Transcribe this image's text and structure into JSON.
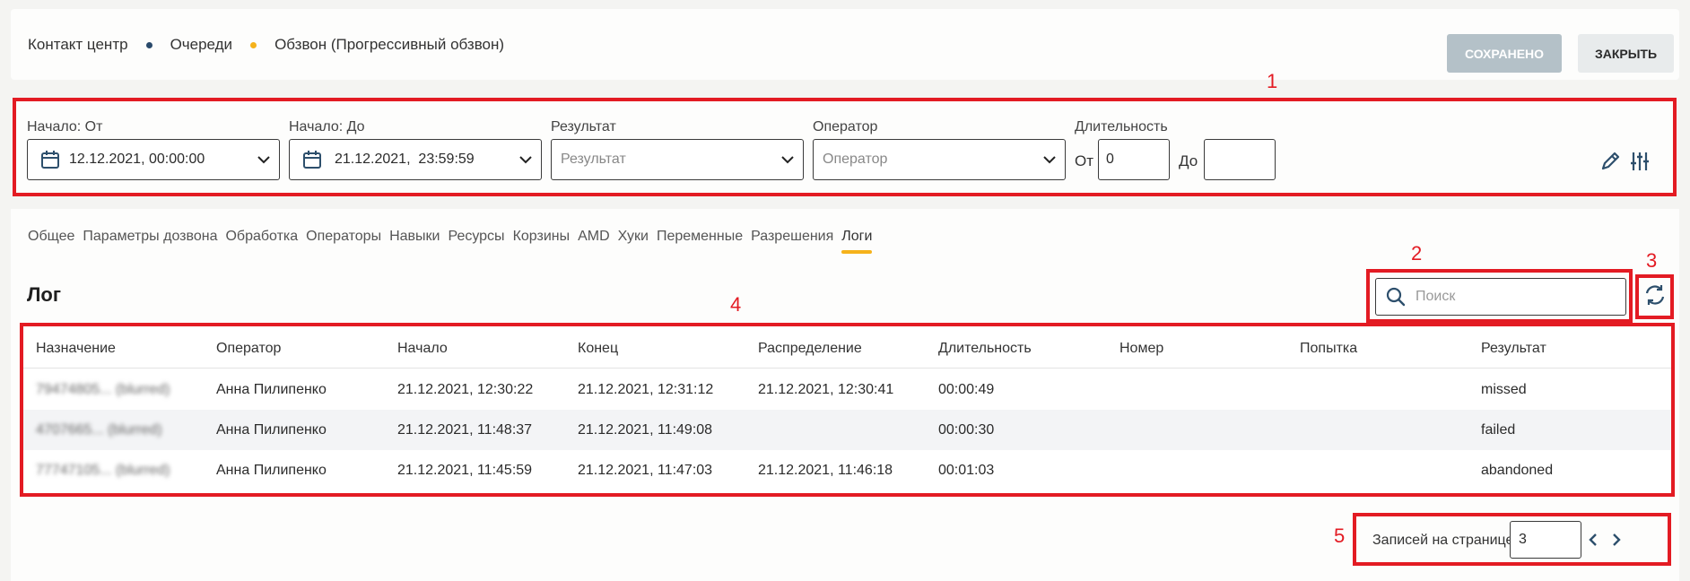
{
  "breadcrumb": {
    "items": [
      "Контакт центр",
      "Очереди",
      "Обзвон (Прогрессивный обзвон)"
    ],
    "sep_colors": [
      "#2a4a6b",
      "#f5b21b"
    ]
  },
  "header": {
    "saved_label": "СОХРАНЕНО",
    "close_label": "ЗАКРЫТЬ"
  },
  "filters": {
    "start_from": {
      "label": "Начало: От",
      "value": "12.12.2021, 00:00:00"
    },
    "start_to": {
      "label": "Начало: До",
      "value": "21.12.2021,  23:59:59"
    },
    "result": {
      "label": "Результат",
      "placeholder": "Результат"
    },
    "operator": {
      "label": "Оператор",
      "placeholder": "Оператор"
    },
    "duration": {
      "label": "Длительность",
      "from_label": "От",
      "from_value": "0",
      "to_label": "До",
      "to_value": ""
    }
  },
  "tabs": [
    "Общее",
    "Параметры дозвона",
    "Обработка",
    "Операторы",
    "Навыки",
    "Ресурсы",
    "Корзины",
    "AMD",
    "Хуки",
    "Переменные",
    "Разрешения",
    "Логи"
  ],
  "active_tab": "Логи",
  "section": {
    "title": "Лог"
  },
  "search": {
    "placeholder": "Поиск"
  },
  "annotations": [
    "1",
    "2",
    "3",
    "4",
    "5"
  ],
  "table": {
    "columns": [
      "Назначение",
      "Оператор",
      "Начало",
      "Конец",
      "Распределение",
      "Длительность",
      "Номер",
      "Попытка",
      "Результат"
    ],
    "rows": [
      [
        "79474805... (blurred)",
        "Анна Пилипенко",
        "21.12.2021, 12:30:22",
        "21.12.2021, 12:31:12",
        "21.12.2021, 12:30:41",
        "00:00:49",
        "",
        "",
        "missed"
      ],
      [
        "4707665... (blurred)",
        "Анна Пилипенко",
        "21.12.2021, 11:48:37",
        "21.12.2021, 11:49:08",
        "",
        "00:00:30",
        "",
        "",
        "failed"
      ],
      [
        "77747105... (blurred)",
        "Анна Пилипенко",
        "21.12.2021, 11:45:59",
        "21.12.2021, 11:47:03",
        "21.12.2021, 11:46:18",
        "00:01:03",
        "",
        "",
        "abandoned"
      ]
    ]
  },
  "pager": {
    "label": "Записей на странице:",
    "value": "3"
  },
  "colors": {
    "accent": "#f5b21b",
    "annotation": "#e31b23",
    "saved_bg": "#b4c1c8"
  },
  "icons": [
    "calendar-icon",
    "chevron-down-icon",
    "pencil-icon",
    "sliders-icon",
    "search-icon",
    "refresh-icon",
    "chevron-left-icon",
    "chevron-right-icon"
  ]
}
